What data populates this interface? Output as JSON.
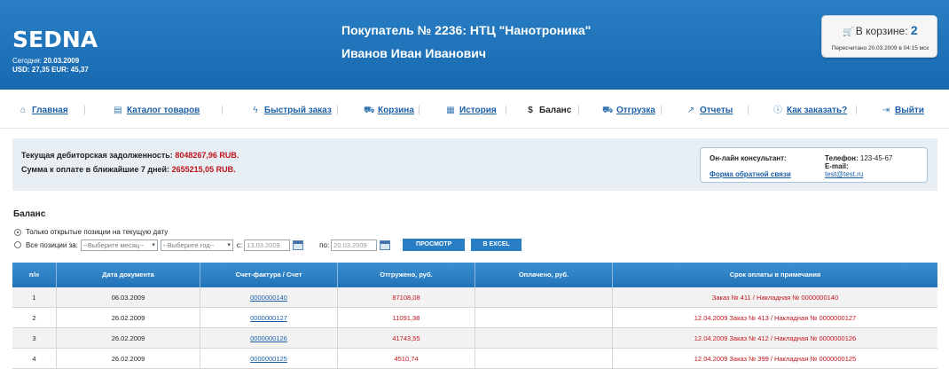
{
  "header": {
    "logo": "SEDNA",
    "today_label": "Сегодня:",
    "today_date": "20.03.2009",
    "rates": "USD: 27,35 EUR: 45,37",
    "buyer_title": "Покупатель № 2236: НТЦ \"Нанотроника\"",
    "person_name": "Иванов Иван Иванович",
    "cart": {
      "label": "В корзине:",
      "count": "2",
      "recalc": "Пересчитано 20.03.2009 в 04:15 мск"
    }
  },
  "nav": {
    "items": [
      {
        "label": "Главная",
        "icon": "home-icon",
        "active": false
      },
      {
        "label": "Каталог товаров",
        "icon": "catalog-icon",
        "active": false
      },
      {
        "label": "Быстрый заказ",
        "icon": "lightning-icon",
        "active": false
      },
      {
        "label": "Корзина",
        "icon": "cart-icon",
        "active": false
      },
      {
        "label": "История",
        "icon": "calendar-icon",
        "active": false
      },
      {
        "label": "Баланс",
        "icon": "dollar-icon",
        "active": true
      },
      {
        "label": "Отгрузка",
        "icon": "truck-icon",
        "active": false
      },
      {
        "label": "Отчеты",
        "icon": "chart-icon",
        "active": false
      },
      {
        "label": "Как заказать?",
        "icon": "info-icon",
        "active": false
      },
      {
        "label": "Выйти",
        "icon": "exit-icon",
        "active": false
      }
    ]
  },
  "info": {
    "debt_label": "Текущая дебиторская задолженность:",
    "debt_value": "8048267,96 RUB.",
    "due_label": "Сумма к оплате в ближайшие 7 дней:",
    "due_value": "2655215,05 RUB.",
    "consultant": {
      "title": "Он-лайн консультант:",
      "form_link": "Форма обратной связи",
      "phone_label": "Телефон:",
      "phone_value": "123-45-67",
      "email_label": "E-mail:",
      "email_value": "test@test.ru"
    }
  },
  "balance": {
    "title": "Баланс",
    "option_open": "Только открытые позиции на текущую дату",
    "option_all": "Все позиции за:",
    "month_placeholder": "--Выберите месяц--",
    "year_placeholder": "--Выберите год--",
    "from_label": "с:",
    "from_date": "13.03.2009",
    "to_label": "по:",
    "to_date": "20.03.2009",
    "view_button": "ПРОСМОТР",
    "excel_button": "В EXCEL"
  },
  "table": {
    "columns": [
      "п/н",
      "Дата документа",
      "Счет-фактура / Счет",
      "Отгружено, руб.",
      "Оплачено, руб.",
      "Срок оплаты в примечания"
    ],
    "rows": [
      {
        "n": "1",
        "date": "06.03.2009",
        "invoice": "0000000140",
        "shipped": "87108,08",
        "paid": "",
        "note": "Заказ № 411 / Накладная № 0000000140"
      },
      {
        "n": "2",
        "date": "26.02.2009",
        "invoice": "0000000127",
        "shipped": "11091,38",
        "paid": "",
        "note": "12.04.2009 Заказ № 413 / Накладная № 0000000127"
      },
      {
        "n": "3",
        "date": "26.02.2009",
        "invoice": "0000000126",
        "shipped": "41743,55",
        "paid": "",
        "note": "12.04.2009 Заказ № 412 / Накладная № 0000000126"
      },
      {
        "n": "4",
        "date": "26.02.2009",
        "invoice": "0000000125",
        "shipped": "4510,74",
        "paid": "",
        "note": "12.04.2009 Заказ № 399 / Накладная № 0000000125"
      }
    ]
  },
  "colors": {
    "header_blue": "#1769b0",
    "link_blue": "#1a5fa8",
    "accent_red": "#c0141c",
    "info_bg": "#e7eef4"
  }
}
